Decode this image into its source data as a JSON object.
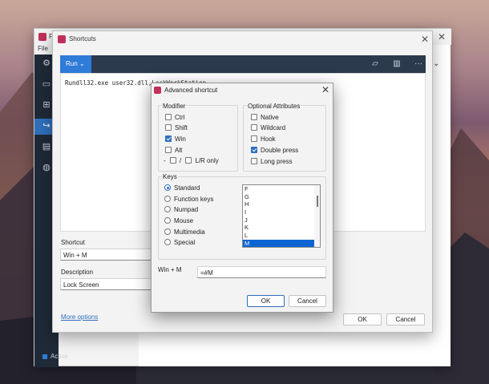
{
  "app": {
    "title": "F",
    "menu": "File",
    "status": "Active"
  },
  "shortcuts_dialog": {
    "title": "Shortcuts",
    "run_label": "Run",
    "command": "Rundll32.exe user32.dll,LockWorkStation",
    "shortcut_label": "Shortcut",
    "shortcut_value": "Win + M",
    "description_label": "Description",
    "description_value": "Lock Screen",
    "more_options": "More options",
    "ok_label": "OK",
    "cancel_label": "Cancel"
  },
  "advanced_dialog": {
    "title": "Advanced shortcut",
    "modifier_title": "Modifier",
    "modifiers": [
      {
        "label": "Ctrl",
        "checked": false
      },
      {
        "label": "Shift",
        "checked": false
      },
      {
        "label": "Win",
        "checked": true
      },
      {
        "label": "Alt",
        "checked": false
      }
    ],
    "lr_prefix": "-",
    "lr_sep": "/",
    "lr_label": "L/R only",
    "optional_title": "Optional Attributes",
    "optional": [
      {
        "label": "Native",
        "checked": false
      },
      {
        "label": "Wildcard",
        "checked": false
      },
      {
        "label": "Hook",
        "checked": false
      },
      {
        "label": "Double press",
        "checked": true
      },
      {
        "label": "Long press",
        "checked": false
      }
    ],
    "keys_title": "Keys",
    "key_types": [
      {
        "label": "Standard",
        "checked": true
      },
      {
        "label": "Function keys",
        "checked": false
      },
      {
        "label": "Numpad",
        "checked": false
      },
      {
        "label": "Mouse",
        "checked": false
      },
      {
        "label": "Multimedia",
        "checked": false
      },
      {
        "label": "Special",
        "checked": false
      }
    ],
    "key_list": [
      "F",
      "G",
      "H",
      "I",
      "J",
      "K",
      "L",
      "M"
    ],
    "selected_key": "M",
    "preview_label": "Win + M",
    "preview_value": "=#M",
    "ok_label": "OK",
    "cancel_label": "Cancel"
  }
}
